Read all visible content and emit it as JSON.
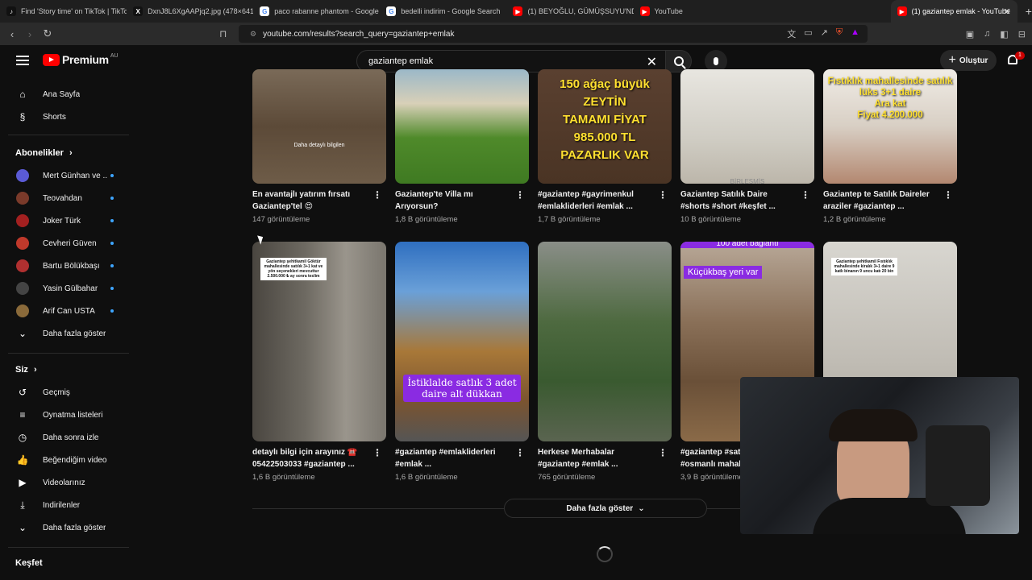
{
  "browser": {
    "tabs": [
      {
        "title": "Find 'Story time' on TikTok | TikTok S",
        "fav": "♪",
        "favbg": "#111",
        "favcolor": "#fff"
      },
      {
        "title": "DxnJ8L6XgAAPjq2.jpg (478×641)",
        "fav": "X",
        "favbg": "#111",
        "favcolor": "#fff"
      },
      {
        "title": "paco rabanne phantom - Google Se",
        "fav": "G",
        "favbg": "#fff",
        "favcolor": "#4285f4"
      },
      {
        "title": "bedelli indirim - Google Search",
        "fav": "G",
        "favbg": "#fff",
        "favcolor": "#4285f4"
      },
      {
        "title": "(1) BEYOĞLU, GÜMÜŞSUYU'NDA DE",
        "fav": "▶",
        "favbg": "#ff0000",
        "favcolor": "#fff"
      },
      {
        "title": "YouTube",
        "fav": "▶",
        "favbg": "#ff0000",
        "favcolor": "#fff"
      },
      {
        "title": "(1) gaziantep emlak - YouTube",
        "fav": "▶",
        "favbg": "#ff0000",
        "favcolor": "#fff"
      }
    ],
    "url": "youtube.com/results?search_query=gaziantep+emlak"
  },
  "header": {
    "logo": "Premium",
    "logo_region": "AU",
    "search_value": "gaziantep emlak",
    "create_label": "Oluştur",
    "notif_count": "1"
  },
  "sidebar": {
    "main": [
      {
        "label": "Ana Sayfa",
        "icon": "⌂",
        "name": "home-icon"
      },
      {
        "label": "Shorts",
        "icon": "§",
        "name": "shorts-icon"
      }
    ],
    "subs_header": "Abonelikler",
    "subs": [
      {
        "label": "Mert Günhan ve ...",
        "color": "#5b5bd6"
      },
      {
        "label": "Teovahdan",
        "color": "#7a3a2a"
      },
      {
        "label": "Joker Türk",
        "color": "#a32020"
      },
      {
        "label": "Cevheri Güven",
        "color": "#c0392b"
      },
      {
        "label": "Bartu Bölükbaşı",
        "color": "#b03030"
      },
      {
        "label": "Yasin Gülbahar",
        "color": "#444"
      },
      {
        "label": "Arif Can USTA",
        "color": "#8a6a3a"
      }
    ],
    "subs_more": "Daha fazla göster",
    "you_header": "Siz",
    "you": [
      {
        "label": "Geçmiş",
        "icon": "↺",
        "name": "history-icon"
      },
      {
        "label": "Oynatma listeleri",
        "icon": "≡",
        "name": "playlist-icon"
      },
      {
        "label": "Daha sonra izle",
        "icon": "◷",
        "name": "watch-later-icon"
      },
      {
        "label": "Beğendiğim videolar",
        "icon": "👍",
        "name": "like-icon"
      },
      {
        "label": "Videolarınız",
        "icon": "▶",
        "name": "your-videos-icon"
      },
      {
        "label": "İndirilenler",
        "icon": "⤓",
        "name": "download-icon"
      },
      {
        "label": "Daha fazla göster",
        "icon": "⌄",
        "name": "chevron-down-icon"
      }
    ],
    "explore_header": "Keşfet"
  },
  "videos_row1": [
    {
      "title": "En avantajlı yatırım fırsatı Gaziantep'tel 😍",
      "views": "147 görüntüleme",
      "overlay": "Daha detaylı bilgilen",
      "bg": "linear-gradient(180deg,#7a6a58 0%,#5c4a38 50%,#6e5c48 100%)"
    },
    {
      "title": "Gaziantep'te Villa mı Arıyorsun?",
      "views": "1,8 B görüntüleme",
      "overlay": "",
      "bg": "linear-gradient(180deg,#9bb8c8 0%,#d8d0b8 30%,#4f8a2a 60%,#3f7a22 100%)"
    },
    {
      "title": "#gaziantep #gayrimenkul #emlakliderleri #emlak ...",
      "views": "1,7 B görüntüleme",
      "overlay": "150 ağaç büyük ZEYTİN\nTAMAMI FİYAT 985.000 TL PAZARLIK VAR",
      "bg": "linear-gradient(180deg,#5a4030 0%,#4a3424 100%)"
    },
    {
      "title": "Gaziantep Satılık Daire #shorts #short #keşfet ...",
      "views": "10 B görüntüleme",
      "overlay": "BİRLEŞMİŞ",
      "bg": "linear-gradient(180deg,#e8e6e0 0%,#d0cdc4 60%,#bcb6aa 100%)"
    },
    {
      "title": "Gaziantep te Satılık Daireler araziler #gaziantep ...",
      "views": "1,2 B görüntüleme",
      "overlay": "Fıstıklık mahallesinde satılık lüks 3+1 daire\nAra kat\nFiyat 4.200.000",
      "bg": "linear-gradient(180deg,#f0ece6 0%,#d8cfc4 50%,#b38870 100%)"
    }
  ],
  "videos_row2": [
    {
      "title": "detaylı bilgi için arayınız ☎️ 05422503033 #gaziantep ...",
      "views": "1,6 B görüntüleme",
      "overlay": "Gaziantep şehitkamil Göktür mahallesinde satılık 3+1 kat ve yön seçenekleri mevcuttur 2.500.000 ₺ ay sonra teslim",
      "bg": "linear-gradient(90deg,#4a4640 0%,#6e6a62 40%,#9a958c 70%,#7a766e 100%)"
    },
    {
      "title": "#gaziantep #emlakliderleri #emlak ...",
      "views": "1,6 B görüntüleme",
      "overlay": "İstiklalde satlık 3 adet daire alt dükkan",
      "bg": "linear-gradient(180deg,#2f6fc0 0%,#6aa0d8 25%,#a87838 55%,#7a5430 80%,#555 100%)"
    },
    {
      "title": "Herkese Merhabalar #gaziantep #emlak ...",
      "views": "765 görüntüleme",
      "overlay": "",
      "bg": "linear-gradient(180deg,#8a8e88 0%,#4e6a40 40%,#3a5a30 70%,#5a6450 100%)"
    },
    {
      "title": "#gaziantep #satılıkarsa #osmanlı mahallesi ...",
      "views": "3,9 B görüntüleme",
      "overlay": "Küçükbaş yeri var",
      "top_overlay": "100 adet bağlantı",
      "bg": "linear-gradient(180deg,#b8a898 0%,#8a7058 40%,#6a5038 70%,#8a6a48 100%)"
    },
    {
      "title": "",
      "views": "",
      "overlay": "Gaziantep şehitkamil Fıstıklık mahallesinde kiralık 3+1 daire 9 katlı binanın 9 uncu katı 20 bin",
      "bg": "linear-gradient(180deg,#d8d6d0 0%,#c0bcb4 60%,#a8a49a 100%)"
    }
  ],
  "more_button": "Daha fazla göster"
}
